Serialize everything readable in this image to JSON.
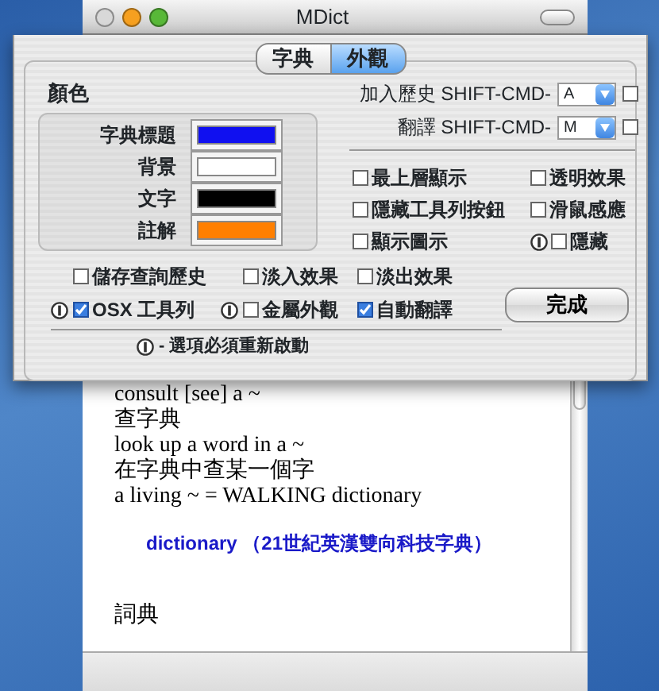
{
  "window": {
    "title": "MDict"
  },
  "preferences": {
    "tabs": [
      {
        "label": "字典",
        "selected": false
      },
      {
        "label": "外觀",
        "selected": true
      }
    ],
    "colors": {
      "heading": "顏色",
      "items": [
        {
          "label": "字典標題",
          "color": "#1010f0"
        },
        {
          "label": "背景",
          "color": "#ffffff"
        },
        {
          "label": "文字",
          "color": "#000000"
        },
        {
          "label": "註解",
          "color": "#ff7f00"
        }
      ]
    },
    "hotkeys": [
      {
        "label": "加入歷史 SHIFT-CMD-",
        "key": "A",
        "checked": false
      },
      {
        "label": "翻譯 SHIFT-CMD-",
        "key": "M",
        "checked": false
      }
    ],
    "display_options": [
      {
        "label": "最上層顯示",
        "checked": false,
        "needs_restart": false
      },
      {
        "label": "透明效果",
        "checked": false,
        "needs_restart": false
      },
      {
        "label": "隱藏工具列按鈕",
        "checked": false,
        "needs_restart": false
      },
      {
        "label": "滑鼠感應",
        "checked": false,
        "needs_restart": false
      },
      {
        "label": "顯示圖示",
        "checked": false,
        "needs_restart": false
      },
      {
        "label": "隱藏",
        "checked": false,
        "needs_restart": true
      }
    ],
    "general_options": [
      {
        "label": "儲存查詢歷史",
        "checked": false,
        "needs_restart": false
      },
      {
        "label": "淡入效果",
        "checked": false,
        "needs_restart": false
      },
      {
        "label": "淡出效果",
        "checked": false,
        "needs_restart": false
      },
      {
        "label": "OSX 工具列",
        "checked": true,
        "needs_restart": true
      },
      {
        "label": "金屬外觀",
        "checked": false,
        "needs_restart": true
      },
      {
        "label": "自動翻譯",
        "checked": true,
        "needs_restart": false
      }
    ],
    "note": "- 選項必須重新啟動",
    "done_button": "完成"
  },
  "content": {
    "lines": [
      {
        "kind": "text",
        "text": "consult [see] a ~"
      },
      {
        "kind": "text",
        "text": "查字典"
      },
      {
        "kind": "text",
        "text": "look up a word in a ~"
      },
      {
        "kind": "text",
        "text": "在字典中查某一個字"
      },
      {
        "kind": "text",
        "text": "a living ~ = WALKING dictionary"
      },
      {
        "kind": "heading",
        "text": "dictionary （21世紀英漢雙向科技字典）"
      },
      {
        "kind": "text",
        "text": "詞典"
      }
    ]
  }
}
